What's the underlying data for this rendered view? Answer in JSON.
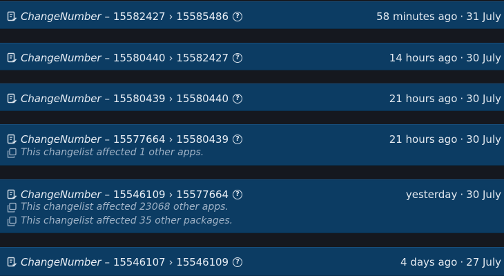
{
  "change_prefix": "ChangeNumber",
  "dash": "–",
  "arrow": "›",
  "dot": "·",
  "help_glyph": "?",
  "colors": {
    "page_background": "#15181f",
    "card_background": "#0c3c63",
    "text_primary": "#e7edf4",
    "text_muted": "#9fb2c6"
  },
  "icons": {
    "changelist": "changelist-icon",
    "copy": "copy-icon",
    "help": "help-circle-icon"
  },
  "items": [
    {
      "from": "15582427",
      "to": "15585486",
      "relative_time": "58 minutes ago",
      "date": "31 July",
      "notes": []
    },
    {
      "from": "15580440",
      "to": "15582427",
      "relative_time": "14 hours ago",
      "date": "30 July",
      "notes": []
    },
    {
      "from": "15580439",
      "to": "15580440",
      "relative_time": "21 hours ago",
      "date": "30 July",
      "notes": []
    },
    {
      "from": "15577664",
      "to": "15580439",
      "relative_time": "21 hours ago",
      "date": "30 July",
      "notes": [
        "This changelist affected 1 other apps."
      ]
    },
    {
      "from": "15546109",
      "to": "15577664",
      "relative_time": "yesterday",
      "date": "30 July",
      "notes": [
        "This changelist affected 23068 other apps.",
        "This changelist affected 35 other packages."
      ]
    },
    {
      "from": "15546107",
      "to": "15546109",
      "relative_time": "4 days ago",
      "date": "27 July",
      "notes": []
    }
  ]
}
